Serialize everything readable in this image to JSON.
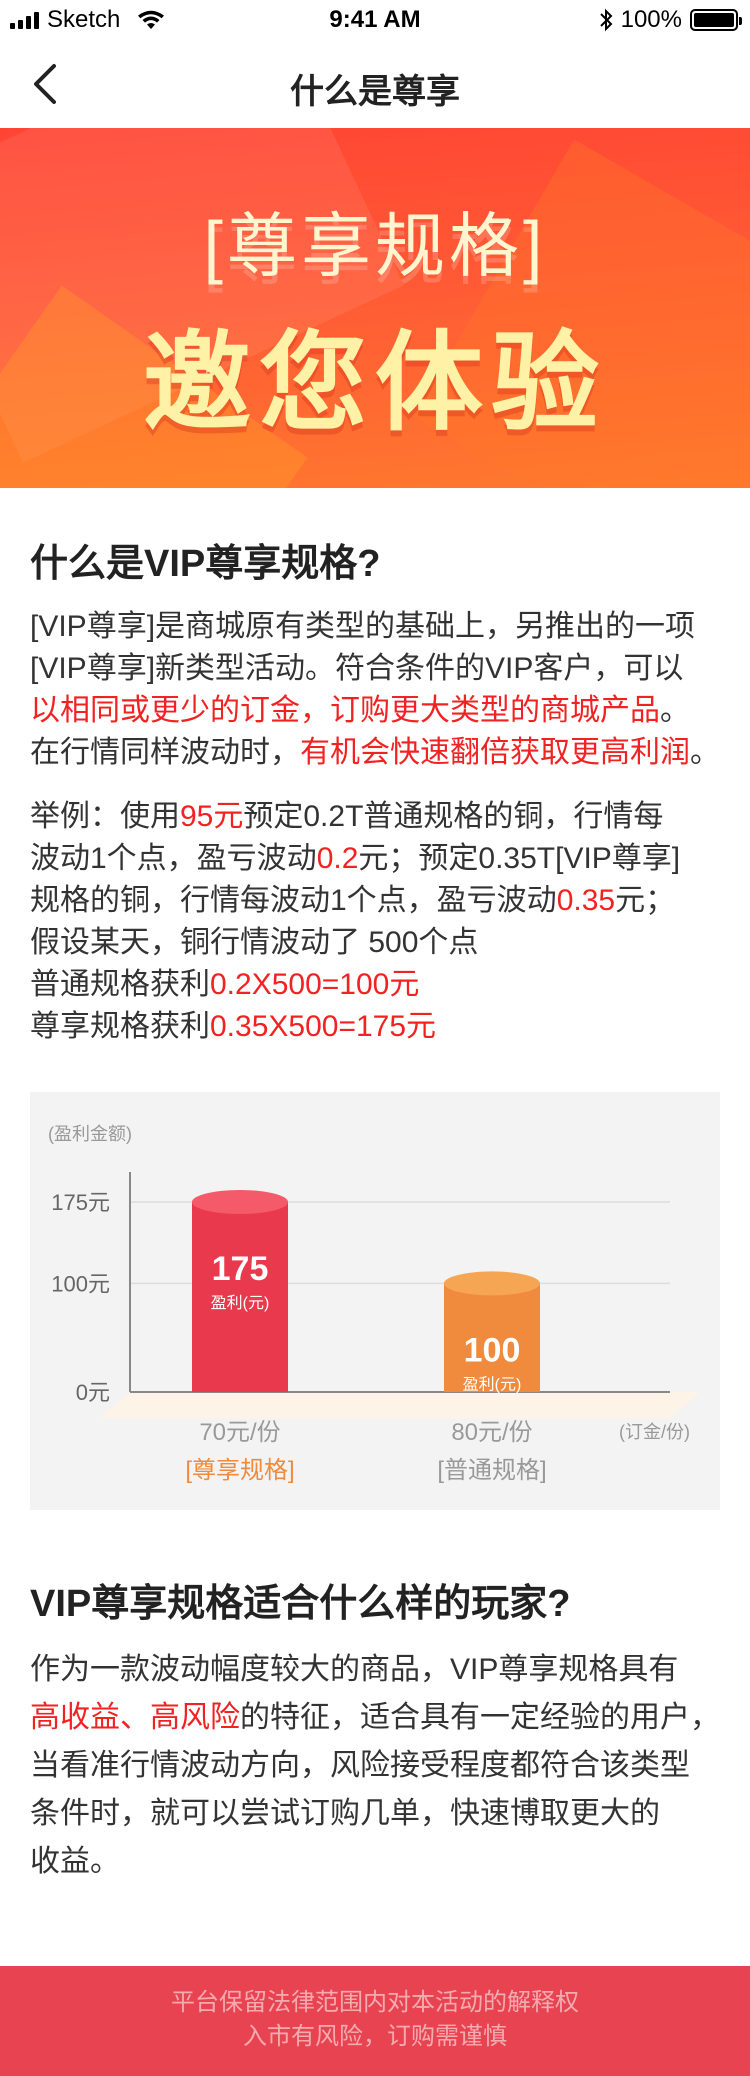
{
  "status_bar": {
    "carrier": "Sketch",
    "time": "9:41 AM",
    "battery": "100%"
  },
  "navbar": {
    "title": "什么是尊享"
  },
  "banner": {
    "subtitle": "[尊享规格]",
    "main": "邀您体验"
  },
  "section1": {
    "heading": "什么是VIP尊享规格?",
    "intro_lines": [
      [
        {
          "text": "[VIP尊享]是商城原有类型的基础上，另推出的一项",
          "red": false
        }
      ],
      [
        {
          "text": "[VIP尊享]新类型活动。符合条件的VIP客户，可以",
          "red": false
        }
      ],
      [
        {
          "text": "以相同或更少的订金，订购更大类型的商城产品",
          "red": true
        },
        {
          "text": "。",
          "red": false
        }
      ],
      [
        {
          "text": "在行情同样波动时，",
          "red": false
        },
        {
          "text": "有机会快速翻倍获取更高利润",
          "red": true
        },
        {
          "text": "。",
          "red": false
        }
      ]
    ],
    "example_lines": [
      [
        {
          "text": "举例：使用",
          "red": false
        },
        {
          "text": "95元",
          "red": true
        },
        {
          "text": "预定0.2T普通规格的铜，行情每",
          "red": false
        }
      ],
      [
        {
          "text": "波动1个点，盈亏波动",
          "red": false
        },
        {
          "text": "0.2",
          "red": true
        },
        {
          "text": "元；预定0.35T[VIP尊享]",
          "red": false
        }
      ],
      [
        {
          "text": "规格的铜，行情每波动1个点，盈亏波动",
          "red": false
        },
        {
          "text": "0.35",
          "red": true
        },
        {
          "text": "元；",
          "red": false
        }
      ],
      [
        {
          "text": "假设某天，铜行情波动了 500个点",
          "red": false
        }
      ],
      [
        {
          "text": "普通规格获利",
          "red": false
        },
        {
          "text": "0.2X500=100元",
          "red": true
        }
      ],
      [
        {
          "text": "尊享规格获利",
          "red": false
        },
        {
          "text": "0.35X500=175元",
          "red": true
        }
      ]
    ]
  },
  "chart_data": {
    "type": "bar",
    "ylabel": "(盈利金额)",
    "xlabel": "(订金/份)",
    "ylim": [
      0,
      175
    ],
    "y_ticks": [
      {
        "value": 175,
        "label": "175元"
      },
      {
        "value": 100,
        "label": "100元"
      },
      {
        "value": 0,
        "label": "0元"
      }
    ],
    "bars": [
      {
        "value": 175,
        "value_label": "175",
        "unit_label": "盈利(元)",
        "x_label": "70元/份",
        "category": "[尊享规格]",
        "color": "#e83a4c",
        "top_color": "#f55a6a",
        "category_color": "#f08a3c"
      },
      {
        "value": 100,
        "value_label": "100",
        "unit_label": "盈利(元)",
        "x_label": "80元/份",
        "category": "[普通规格]",
        "color": "#f08a3c",
        "top_color": "#f6a552",
        "category_color": "#999999"
      }
    ]
  },
  "section2": {
    "heading": "VIP尊享规格适合什么样的玩家?",
    "lines": [
      [
        {
          "text": "作为一款波动幅度较大的商品，VIP尊享规格具有",
          "red": false
        }
      ],
      [
        {
          "text": "高收益、高风险",
          "red": true
        },
        {
          "text": "的特征，适合具有一定经验的用户，",
          "red": false
        }
      ],
      [
        {
          "text": "当看准行情波动方向，风险接受程度都符合该类型",
          "red": false
        }
      ],
      [
        {
          "text": "条件时，就可以尝试订购几单，快速博取更大的",
          "red": false
        }
      ],
      [
        {
          "text": "收益。",
          "red": false
        }
      ]
    ]
  },
  "footer": {
    "line1": "平台保留法律范围内对本活动的解释权",
    "line2": "入市有风险，订购需谨慎"
  },
  "colors": {
    "accent_red": "#f22222",
    "footer_bg": "#e84350",
    "banner_text": "#fff1a6"
  }
}
